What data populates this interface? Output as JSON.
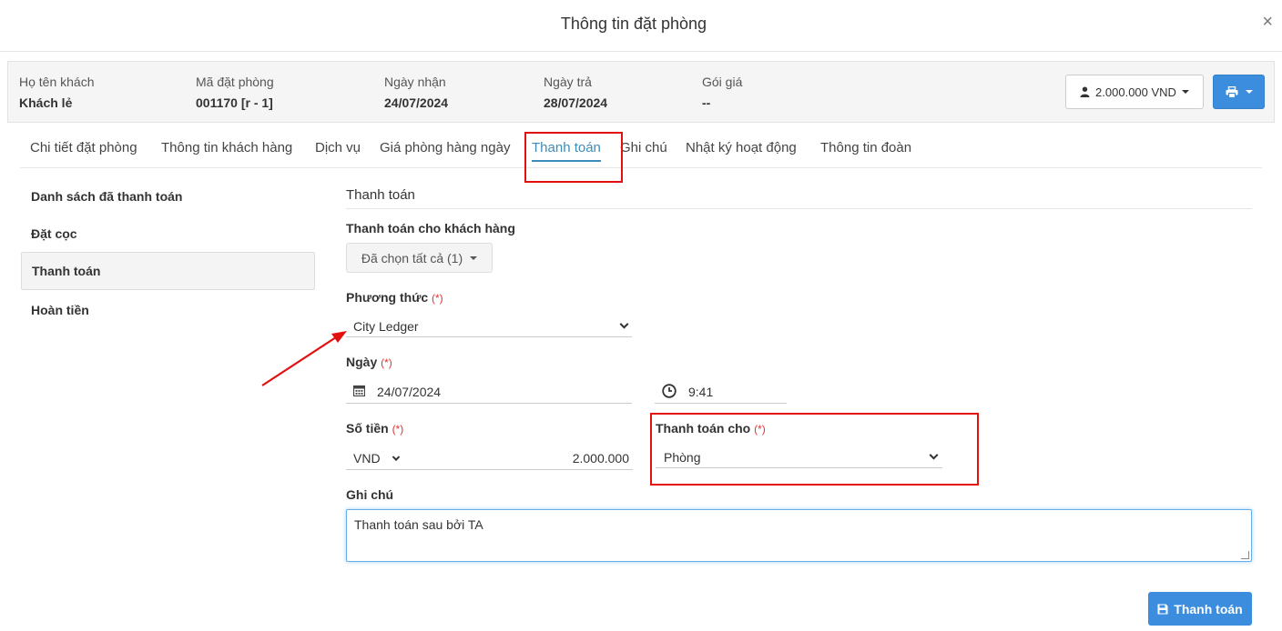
{
  "modal": {
    "title": "Thông tin đặt phòng",
    "close": "×"
  },
  "booking": {
    "guest_label": "Họ tên khách",
    "guest_value": "Khách lẻ",
    "code_label": "Mã đặt phòng",
    "code_value": "001170 [r - 1]",
    "checkin_label": "Ngày nhận",
    "checkin_value": "24/07/2024",
    "checkout_label": "Ngày trả",
    "checkout_value": "28/07/2024",
    "rate_label": "Gói giá",
    "rate_value": "--",
    "total_label": "2.000.000 VND"
  },
  "tabs": [
    {
      "label": "Chi tiết đặt phòng"
    },
    {
      "label": "Thông tin khách hàng"
    },
    {
      "label": "Dịch vụ"
    },
    {
      "label": "Giá phòng hàng ngày"
    },
    {
      "label": "Thanh toán"
    },
    {
      "label": "Ghi chú"
    },
    {
      "label": "Nhật ký hoạt động"
    },
    {
      "label": "Thông tin đoàn"
    }
  ],
  "active_tab": "Thanh toán",
  "sidebar": [
    {
      "label": "Danh sách đã thanh toán"
    },
    {
      "label": "Đặt cọc"
    },
    {
      "label": "Thanh toán"
    },
    {
      "label": "Hoàn tiền"
    }
  ],
  "form": {
    "section_title": "Thanh toán",
    "customer_label": "Thanh toán cho khách hàng",
    "customer_value": "Đã chọn tất cả (1)",
    "method_label": "Phương thức",
    "method_value": "City Ledger",
    "date_label": "Ngày",
    "date_value": "24/07/2024",
    "time_value": "9:41",
    "amount_label": "Số tiền",
    "currency_value": "VND",
    "amount_value": "2.000.000",
    "pay_for_label": "Thanh toán cho",
    "pay_for_value": "Phòng",
    "note_label": "Ghi chú",
    "note_value": "Thanh toán sau bởi TA",
    "required_mark": "(*)",
    "submit_label": "Thanh toán"
  },
  "colors": {
    "primary": "#3c8dde",
    "tab_active": "#3c8dbc",
    "highlight": "#e41010",
    "required": "#dd3333"
  }
}
